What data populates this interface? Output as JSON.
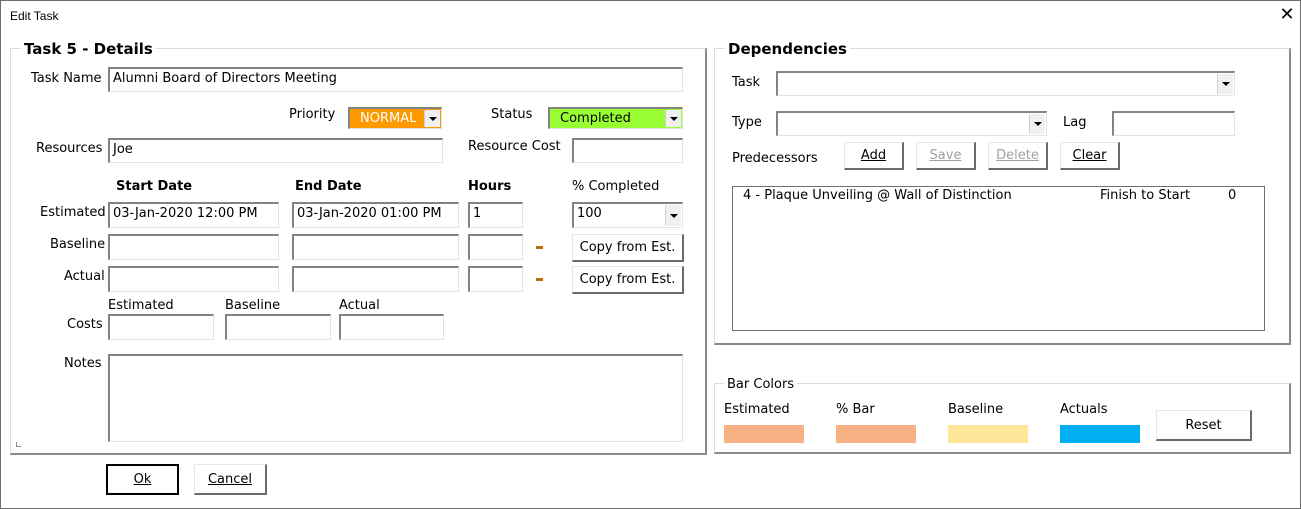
{
  "window": {
    "title": "Edit Task",
    "close_icon": "close-icon"
  },
  "details": {
    "title": "Task 5 - Details",
    "task_name_label": "Task Name",
    "task_name_value": "Alumni Board of Directors Meeting",
    "priority_label": "Priority",
    "priority_value": "NORMAL",
    "priority_color": "#ff9900",
    "status_label": "Status",
    "status_value": "Completed",
    "status_color": "#99ff33",
    "resources_label": "Resources",
    "resources_value": "Joe",
    "resource_cost_label": "Resource Cost",
    "resource_cost_value": "",
    "headers": {
      "start_date": "Start Date",
      "end_date": "End Date",
      "hours": "Hours",
      "pct_completed": "% Completed"
    },
    "rows": {
      "estimated": {
        "label": "Estimated",
        "start": "03-Jan-2020 12:00 PM",
        "end": "03-Jan-2020 01:00 PM",
        "hours": "1",
        "pct": "100"
      },
      "baseline": {
        "label": "Baseline",
        "start": "",
        "end": "",
        "hours": "",
        "copy_label": "Copy from Est."
      },
      "actual": {
        "label": "Actual",
        "start": "",
        "end": "",
        "hours": "",
        "copy_label": "Copy from Est."
      }
    },
    "costs": {
      "label": "Costs",
      "estimated_label": "Estimated",
      "estimated_value": "",
      "baseline_label": "Baseline",
      "baseline_value": "",
      "actual_label": "Actual",
      "actual_value": ""
    },
    "notes_label": "Notes",
    "notes_value": ""
  },
  "dependencies": {
    "title": "Dependencies",
    "task_label": "Task",
    "task_value": "",
    "type_label": "Type",
    "type_value": "",
    "lag_label": "Lag",
    "lag_value": "",
    "predecessors_label": "Predecessors",
    "buttons": {
      "add": "Add",
      "save": "Save",
      "delete": "Delete",
      "clear": "Clear"
    },
    "list": [
      {
        "task": "4 - Plaque Unveiling @ Wall of Distinction",
        "type": "Finish to Start",
        "lag": "0"
      }
    ]
  },
  "bar_colors": {
    "title": "Bar Colors",
    "items": [
      {
        "label": "Estimated",
        "color": "#f8b185"
      },
      {
        "label": "% Bar",
        "color": "#f8b185"
      },
      {
        "label": "Baseline",
        "color": "#ffe699"
      },
      {
        "label": "Actuals",
        "color": "#00b0f0"
      }
    ],
    "reset_label": "Reset"
  },
  "footer": {
    "ok_label": "Ok",
    "cancel_label": "Cancel"
  }
}
